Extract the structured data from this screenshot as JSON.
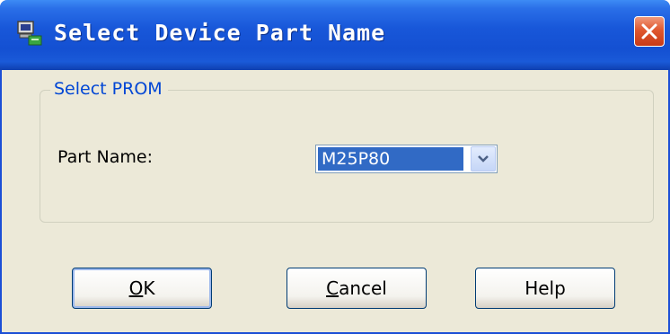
{
  "window": {
    "title": "Select Device Part Name",
    "icon": "app-monitor-icon",
    "close_icon": "close-icon"
  },
  "group": {
    "legend": "Select PROM"
  },
  "part_name": {
    "label": "Part Name:",
    "selected_value": "M25P80"
  },
  "buttons": {
    "ok": {
      "accel": "O",
      "rest": "K"
    },
    "cancel": {
      "accel": "C",
      "rest": "ancel"
    },
    "help": {
      "label": "Help"
    }
  },
  "colors": {
    "titlebar": "#1450d2",
    "dialog_background": "#ece9d8",
    "group_legend": "#0046d5",
    "selection": "#316ac5",
    "close_button": "#e0582f"
  }
}
